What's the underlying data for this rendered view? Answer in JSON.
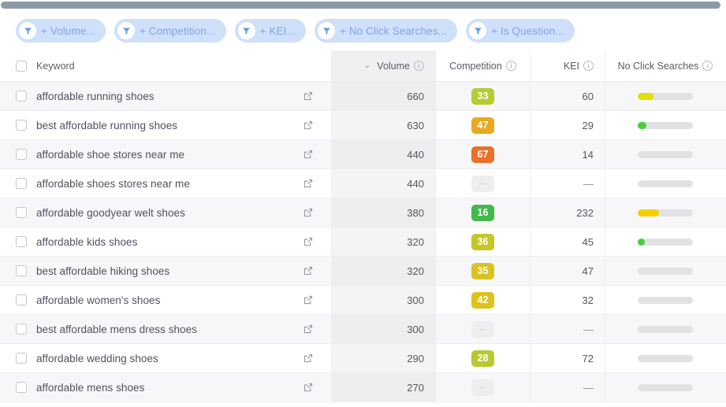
{
  "scrollbar": {
    "name": "horizontal-scrollbar"
  },
  "filters": {
    "chips": [
      {
        "label": "+ Volume...",
        "icon": "filter-funnel-icon"
      },
      {
        "label": "+ Competition...",
        "icon": "filter-funnel-icon"
      },
      {
        "label": "+ KEI...",
        "icon": "filter-funnel-icon"
      },
      {
        "label": "+ No Click Searches...",
        "icon": "filter-funnel-icon"
      },
      {
        "label": "+ Is Question...",
        "icon": "filter-funnel-icon"
      }
    ],
    "chip_bg": "#cfe0fb",
    "chip_text_color": "#7fa4e8"
  },
  "table": {
    "columns": [
      {
        "key": "keyword",
        "label": "Keyword",
        "has_info": false,
        "sorted": false
      },
      {
        "key": "volume",
        "label": "Volume",
        "has_info": true,
        "sorted": true,
        "sort_dir": "desc",
        "sort_caret": "⌄"
      },
      {
        "key": "competition",
        "label": "Competition",
        "has_info": true,
        "sorted": false
      },
      {
        "key": "kei",
        "label": "KEI",
        "has_info": true,
        "sorted": false
      },
      {
        "key": "no_click_searches",
        "label": "No Click Searches",
        "has_info": true,
        "sorted": false
      }
    ],
    "select_all_checkbox": "unchecked",
    "rows": [
      {
        "keyword": "affordable running shoes",
        "volume": "660",
        "competition": "33",
        "competition_color": "#b5cc33",
        "kei": "60",
        "bar_pct": 28,
        "bar_color": "#e0e000"
      },
      {
        "keyword": "best affordable running shoes",
        "volume": "630",
        "competition": "47",
        "competition_color": "#eaa81e",
        "kei": "29",
        "bar_pct": 16,
        "bar_color": "#46cf39"
      },
      {
        "keyword": "affordable shoe stores near me",
        "volume": "440",
        "competition": "67",
        "competition_color": "#ea6f2b",
        "kei": "14",
        "bar_pct": 0,
        "bar_color": "#e2e2e4"
      },
      {
        "keyword": "affordable shoes stores near me",
        "volume": "440",
        "competition": "–",
        "competition_color": "",
        "kei": "—",
        "bar_pct": 0,
        "bar_color": "#e2e2e4"
      },
      {
        "keyword": "affordable goodyear welt shoes",
        "volume": "380",
        "competition": "16",
        "competition_color": "#43b94c",
        "kei": "232",
        "bar_pct": 38,
        "bar_color": "#f2d000"
      },
      {
        "keyword": "affordable kids shoes",
        "volume": "320",
        "competition": "36",
        "competition_color": "#c4c62a",
        "kei": "45",
        "bar_pct": 13,
        "bar_color": "#46cf39"
      },
      {
        "keyword": "best affordable hiking shoes",
        "volume": "320",
        "competition": "35",
        "competition_color": "#d8c320",
        "kei": "47",
        "bar_pct": 0,
        "bar_color": "#e2e2e4"
      },
      {
        "keyword": "affordable women's shoes",
        "volume": "300",
        "competition": "42",
        "competition_color": "#dcc31c",
        "kei": "32",
        "bar_pct": 0,
        "bar_color": "#e2e2e4"
      },
      {
        "keyword": "best affordable mens dress shoes",
        "volume": "300",
        "competition": "–",
        "competition_color": "",
        "kei": "—",
        "bar_pct": 0,
        "bar_color": "#e2e2e4"
      },
      {
        "keyword": "affordable wedding shoes",
        "volume": "290",
        "competition": "28",
        "competition_color": "#b7c932",
        "kei": "72",
        "bar_pct": 0,
        "bar_color": "#e2e2e4"
      },
      {
        "keyword": "affordable mens shoes",
        "volume": "270",
        "competition": "–",
        "competition_color": "",
        "kei": "—",
        "bar_pct": 0,
        "bar_color": "#e2e2e4"
      }
    ]
  }
}
